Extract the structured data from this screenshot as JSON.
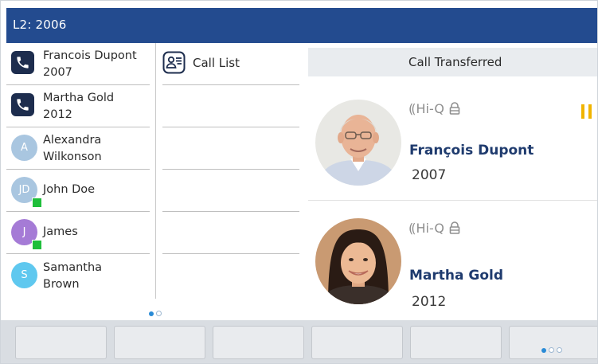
{
  "header": {
    "line_title": "L2: 2006"
  },
  "contacts": [
    {
      "type": "call",
      "line1": "Francois Dupont",
      "line2": "2007"
    },
    {
      "type": "call",
      "line1": "Martha Gold",
      "line2": "2012"
    },
    {
      "type": "avatar",
      "initials": "A",
      "line1": "Alexandra",
      "line2": "Wilkonson",
      "color": "#a9c6e0",
      "status": false
    },
    {
      "type": "avatar",
      "initials": "JD",
      "line1": "John Doe",
      "line2": "",
      "color": "#a9c6e0",
      "status": true
    },
    {
      "type": "avatar",
      "initials": "J",
      "line1": "James",
      "line2": "",
      "color": "#a57bd6",
      "status": true
    },
    {
      "type": "avatar",
      "initials": "S",
      "line1": "Samantha",
      "line2": "Brown",
      "color": "#5fc8ef",
      "status": false
    }
  ],
  "programmable_keys": {
    "call_list_label": "Call List"
  },
  "calls_panel": {
    "banner": "Call Transferred",
    "calls": [
      {
        "audio_label": "Hi-Q",
        "name": "François Dupont",
        "number": "2007",
        "on_hold": true
      },
      {
        "audio_label": "Hi-Q",
        "name": "Martha Gold",
        "number": "2012",
        "on_hold": false
      }
    ]
  },
  "icons": {
    "call_badge": "phone-handset-icon",
    "call_list": "contact-card-icon",
    "audio": "hi-q-wideband-icon",
    "secure": "lock-icon",
    "hold": "hold-icon"
  },
  "colors": {
    "header_bg": "#234b8f",
    "hold": "#f0b400",
    "presence": "#1fbf3b",
    "caller_name": "#1f3b6e"
  }
}
